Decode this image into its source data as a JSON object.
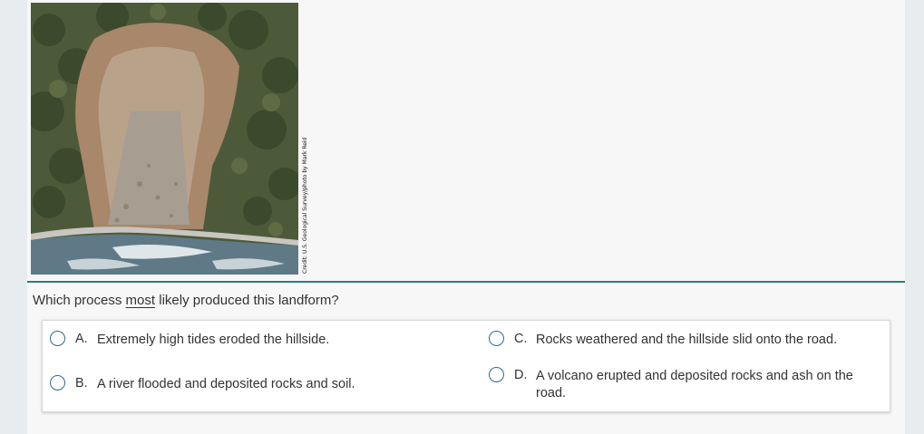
{
  "stimulus": {
    "image_alt": "Landslide hillside above a road and river",
    "credit": "Credit: U.S. Geological Survey/photo by Mark Reid"
  },
  "question": {
    "before": "Which process ",
    "emphasis": "most",
    "after": " likely produced this landform?"
  },
  "options": [
    {
      "letter": "A.",
      "text": "Extremely high tides eroded the hillside."
    },
    {
      "letter": "B.",
      "text": "A river flooded and deposited rocks and soil."
    },
    {
      "letter": "C.",
      "text": "Rocks weathered and the hillside slid onto the road."
    },
    {
      "letter": "D.",
      "text": "A volcano erupted and deposited rocks and ash on the road."
    }
  ],
  "colors": {
    "divider": "#2a7d7d",
    "radio_border": "#2c6b8a",
    "panel_bg": "#f7f7f7",
    "page_bg": "#e9ecef"
  }
}
